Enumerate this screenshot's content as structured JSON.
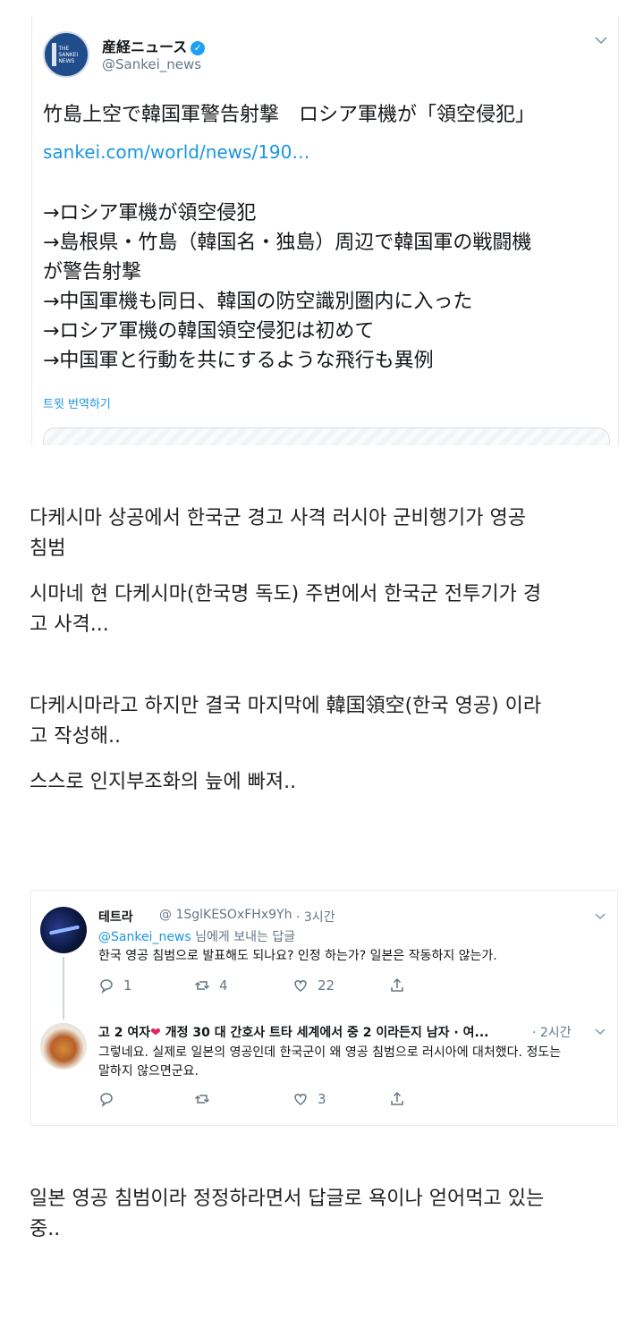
{
  "tweet": {
    "account_name": "産経ニュース",
    "handle": "@Sankei_news",
    "logo_text": "THE SANKEI NEWS",
    "headline": "竹島上空で韓国軍警告射撃　ロシア軍機が「領空侵犯」",
    "link": "sankei.com/world/news/190…",
    "bullets": [
      "→ロシア軍機が領空侵犯",
      "→島根県・竹島（韓国名・独島）周辺で韓国軍の戦闘機",
      "が警告射撃",
      "→中国軍機も同日、韓国の防空識別圏内に入った",
      "→ロシア軍機の韓国領空侵犯は初めて",
      "→中国軍と行動を共にするような飛行も異例"
    ],
    "translate": "트윗 번역하기"
  },
  "commentary": {
    "p1_line1": "다케시마 상공에서 한국군 경고 사격 러시아 군비행기가 영공",
    "p1_line2": "침범",
    "p2_line1": "시마네 현 다케시마(한국명 독도) 주변에서 한국군 전투기가 경",
    "p2_line2": "고 사격...",
    "p3_line1": "다케시마라고 하지만 결국 마지막에 韓国領空(한국 영공) 이라",
    "p3_line2": "고 작성해..",
    "p4": "스스로 인지부조화의 늪에 빠져..",
    "p5_line1": "일본 영공 침범이라 정정하라면서 답글로 욕이나 얻어먹고 있는",
    "p5_line2": "중.."
  },
  "replies": [
    {
      "name": "테트라",
      "handle": "@ 1SglKESOxFHx9Yh",
      "time": "· 3시간",
      "to_handle": "@Sankei_news",
      "to_suffix": " 님에게 보내는 답글",
      "text": "한국 영공 침범으로 발표해도 되나요? 인정 하는가? 일본은 작동하지 않는가.",
      "replies": "1",
      "retweets": "4",
      "likes": "22"
    },
    {
      "name_prefix": "고 2 여자",
      "name_heart": "❤",
      "name_suffix": " 개정 30 대 간호사 트타 세계에서 중 2 이라든지 남자 · 여...",
      "time": "· 2시간",
      "text_line1": "그렇네요. 실제로 일본의 영공인데 한국군이 왜 영공 침범으로 러시아에 대처했다. 정도는",
      "text_line2": "말하지 않으면군요.",
      "replies": "",
      "retweets": "",
      "likes": "3"
    }
  ],
  "icons": {
    "verified": "verified-badge-icon",
    "caret": "chevron-down-icon",
    "reply": "reply-icon",
    "retweet": "retweet-icon",
    "like": "heart-icon",
    "share": "share-icon"
  },
  "colors": {
    "link_blue": "#1b95e0",
    "verified_blue": "#1da1f2",
    "muted_gray": "#657786",
    "heart_red": "#e0245e"
  }
}
